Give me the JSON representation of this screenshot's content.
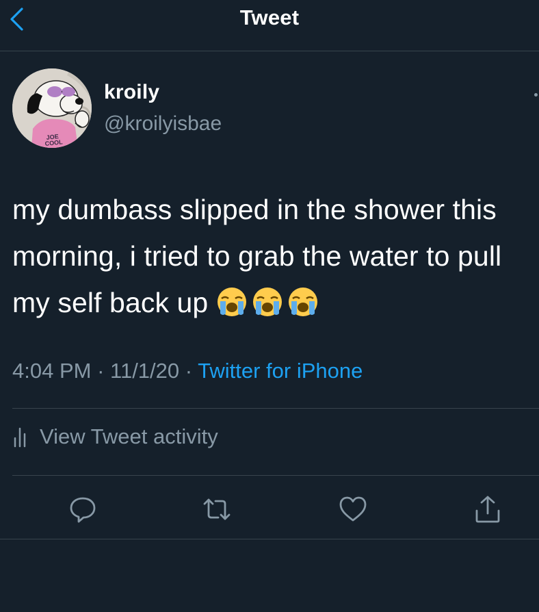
{
  "header": {
    "title": "Tweet"
  },
  "author": {
    "name": "kroily",
    "handle": "@kroilyisbae",
    "avatar_caption": "JOE COOL"
  },
  "tweet": {
    "text": "my dumbass slipped in the shower this morning, i tried to grab the water to pull my self back up",
    "emojis": [
      "loudly-crying-face",
      "loudly-crying-face",
      "loudly-crying-face"
    ]
  },
  "meta": {
    "time": "4:04 PM",
    "separator": " · ",
    "date": "11/1/20",
    "source": "Twitter for iPhone"
  },
  "activity": {
    "label": "View Tweet activity"
  },
  "actions": [
    "reply-icon",
    "retweet-icon",
    "like-icon",
    "share-icon"
  ],
  "colors": {
    "background": "#15202b",
    "accent": "#1da1f2",
    "secondary_text": "#8899a6",
    "divider": "#38444d"
  }
}
